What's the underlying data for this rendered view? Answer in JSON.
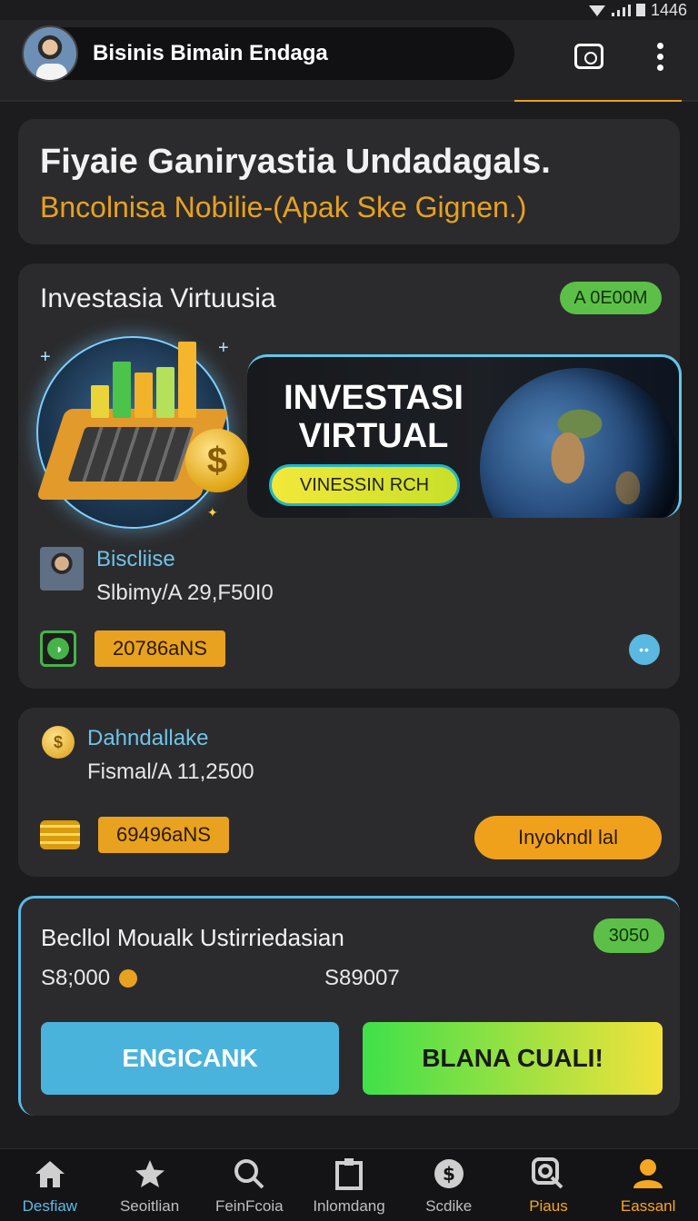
{
  "status_bar": {
    "time": "1446"
  },
  "header": {
    "title": "Bisinis Bimain Endaga"
  },
  "hero": {
    "title": "Fiyaie Ganiryastia Undadagals.",
    "subtitle": "Bncolnisa Nobilie-(Apak Ske Gignen.)"
  },
  "invest_card": {
    "title": "Investasia Virtuusia",
    "badge": "A 0E00M",
    "banner_title": "INVESTASI VIRTUAL",
    "banner_cta": "VINESSIN RCH",
    "user_name": "Biscliise",
    "user_amount": "Slbimy/A 29,F50I0",
    "amount_chip": "20786aNS",
    "more_label": "••"
  },
  "dana_card": {
    "title": "Dahndallake",
    "amount": "Fismal/A 11,2500",
    "chip": "69496aNS",
    "button": "Inyokndl lal"
  },
  "summary_card": {
    "title": "Becllol Moualk Ustirriedasian",
    "badge": "3050",
    "value_left": "S8;000",
    "value_right": "S89007",
    "btn_left": "ENGICANK",
    "btn_right": "BLANA CUALI!"
  },
  "nav": [
    {
      "label": "Desfiaw",
      "icon": "home-icon",
      "color": "#5fb9e6"
    },
    {
      "label": "Seoitlian",
      "icon": "star-icon"
    },
    {
      "label": "FeinFcoia",
      "icon": "search-icon"
    },
    {
      "label": "Inlomdang",
      "icon": "clipboard-icon"
    },
    {
      "label": "Scdike",
      "icon": "dollar-circle-icon"
    },
    {
      "label": "Piaus",
      "icon": "magnifier-icon",
      "color": "#f5a623"
    },
    {
      "label": "Eassanl",
      "icon": "profile-icon",
      "color": "#f5a623"
    }
  ],
  "colors": {
    "accent_orange": "#e8a21f",
    "accent_blue": "#5ab8e6",
    "accent_green": "#5cc048",
    "background": "#1c1c1e",
    "card": "#2b2b2d"
  }
}
